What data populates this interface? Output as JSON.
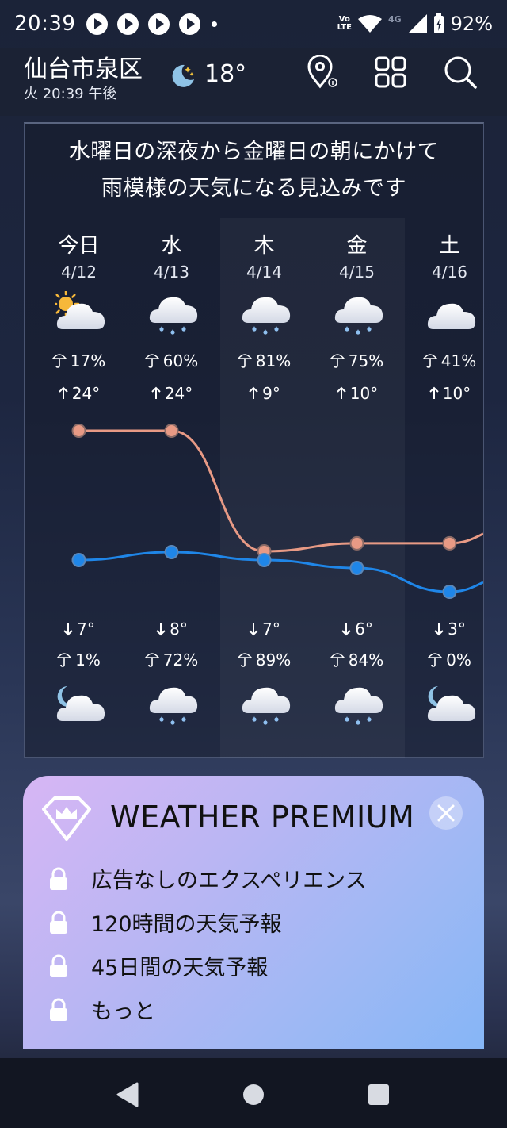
{
  "status_bar": {
    "time": "20:39",
    "volte_top": "Vo",
    "volte_bottom": "LTE",
    "network": "4G",
    "battery": "92%"
  },
  "header": {
    "city": "仙台市泉区",
    "subtitle": "火 20:39 午後",
    "temperature": "18°",
    "icons": [
      "moon-stars-icon",
      "location-info-icon",
      "grid-apps-icon",
      "search-icon"
    ]
  },
  "summary": {
    "line1": "水曜日の深夜から金曜日の朝にかけて",
    "line2": "雨模様の天気になる見込みです"
  },
  "days": [
    {
      "name": "今日",
      "date": "4/12",
      "day_icon": "sun-cloud",
      "day_rain": "17%",
      "high": "24°",
      "low": "7°",
      "night_rain": "1%",
      "night_icon": "moon-cloud",
      "high_value": 24,
      "low_value": 7
    },
    {
      "name": "水",
      "date": "4/13",
      "day_icon": "rain-cloud",
      "day_rain": "60%",
      "high": "24°",
      "low": "8°",
      "night_rain": "72%",
      "night_icon": "rain-cloud",
      "high_value": 24,
      "low_value": 8
    },
    {
      "name": "木",
      "date": "4/14",
      "day_icon": "rain-cloud",
      "day_rain": "81%",
      "high": "9°",
      "low": "7°",
      "night_rain": "89%",
      "night_icon": "rain-cloud",
      "high_value": 9,
      "low_value": 7
    },
    {
      "name": "金",
      "date": "4/15",
      "day_icon": "rain-cloud",
      "day_rain": "75%",
      "high": "10°",
      "low": "6°",
      "night_rain": "84%",
      "night_icon": "rain-cloud",
      "high_value": 10,
      "low_value": 6
    },
    {
      "name": "土",
      "date": "4/16",
      "day_icon": "cloud",
      "day_rain": "41%",
      "high": "10°",
      "low": "3°",
      "night_rain": "0%",
      "night_icon": "moon-cloud",
      "high_value": 10,
      "low_value": 3
    }
  ],
  "colors": {
    "high_line": "#e89a85",
    "low_line": "#1f86e8",
    "highlight_days": [
      "木",
      "金"
    ]
  },
  "premium": {
    "title": "WEATHER PREMIUM",
    "features": [
      "広告なしのエクスペリエンス",
      "120時間の天気予報",
      "45日間の天気予報",
      "もっと"
    ]
  },
  "navbar": {
    "icons": [
      "back-icon",
      "home-icon",
      "recents-icon"
    ]
  }
}
